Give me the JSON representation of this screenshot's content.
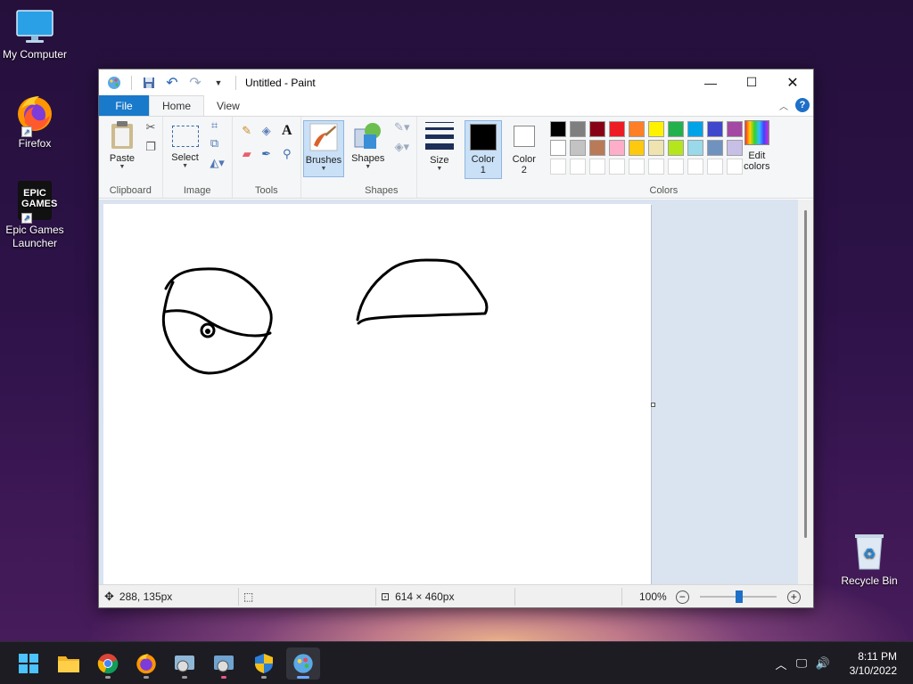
{
  "desktop": {
    "icons": [
      {
        "label": "My Computer"
      },
      {
        "label": "Firefox"
      },
      {
        "label": "Epic Games Launcher",
        "logo_text": "EPIC GAMES"
      },
      {
        "label": "Recycle Bin"
      }
    ]
  },
  "window": {
    "title": "Untitled - Paint",
    "tabs": {
      "file": "File",
      "home": "Home",
      "view": "View"
    },
    "ribbon": {
      "clipboard": {
        "paste": "Paste",
        "group": "Clipboard"
      },
      "image": {
        "select": "Select",
        "group": "Image"
      },
      "tools": {
        "group": "Tools",
        "text_tool": "A"
      },
      "brushes": {
        "label": "Brushes"
      },
      "shapes": {
        "label": "Shapes",
        "group": "Shapes"
      },
      "size": {
        "label": "Size"
      },
      "color1": {
        "line1": "Color",
        "line2": "1",
        "value": "#000000"
      },
      "color2": {
        "line1": "Color",
        "line2": "2",
        "value": "#ffffff"
      },
      "colors_group": "Colors",
      "edit_colors": {
        "line1": "Edit",
        "line2": "colors"
      },
      "palette_row1": [
        "#000000",
        "#7f7f7f",
        "#880015",
        "#ed1c24",
        "#ff7f27",
        "#fff200",
        "#22b14c",
        "#00a2e8",
        "#3f48cc",
        "#a349a4"
      ],
      "palette_row2": [
        "#ffffff",
        "#c3c3c3",
        "#b97a57",
        "#ffaec9",
        "#ffc90e",
        "#efe4b0",
        "#b5e61d",
        "#99d9ea",
        "#7092be",
        "#c8bfe7"
      ]
    },
    "status": {
      "cursor_pos": "288, 135px",
      "canvas_size": "614 × 460px",
      "zoom": "100%"
    }
  },
  "taskbar": {
    "apps": [
      "start",
      "file-explorer",
      "chrome",
      "firefox",
      "app-1",
      "app-2",
      "security",
      "paint"
    ],
    "clock": {
      "time": "8:11 PM",
      "date": "3/10/2022"
    }
  }
}
